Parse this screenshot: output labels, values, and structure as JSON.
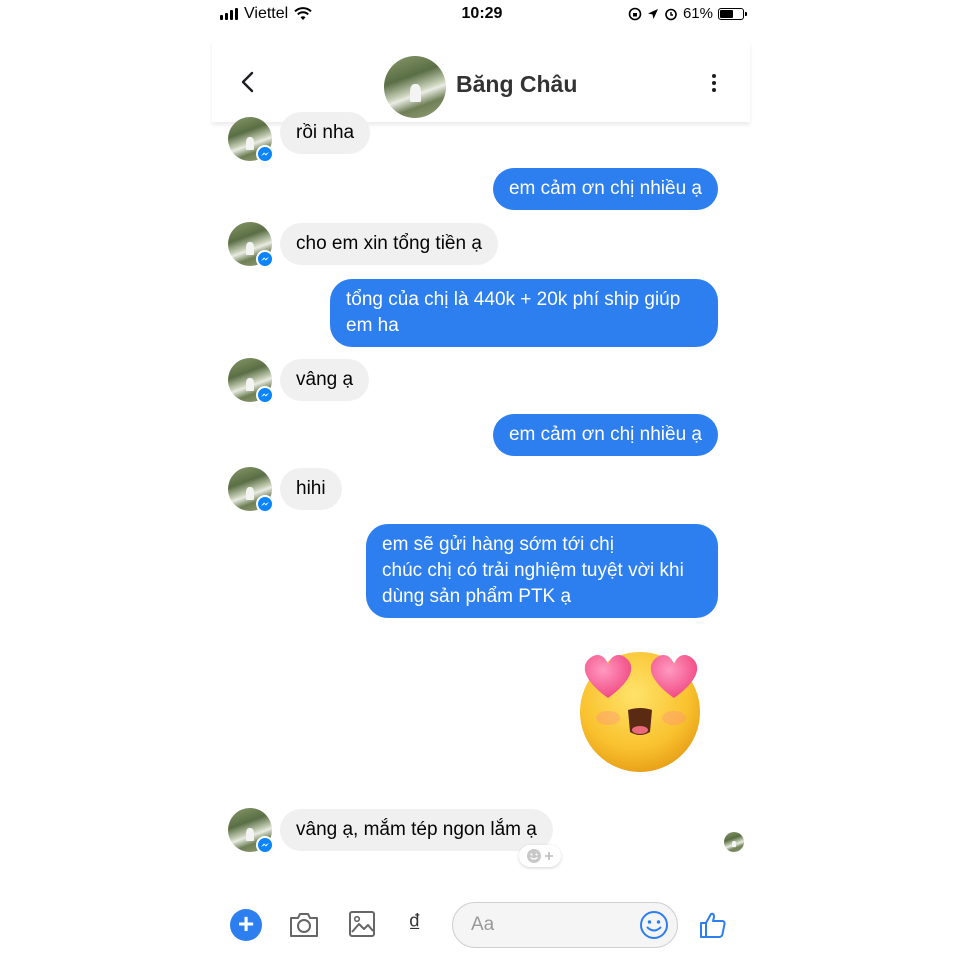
{
  "status_bar": {
    "carrier": "Viettel",
    "time": "10:29",
    "battery_percent": "61%",
    "battery_level": 0.61
  },
  "header": {
    "contact_name": "Băng Châu"
  },
  "messages": [
    {
      "from": "contact",
      "text": "rồi nha"
    },
    {
      "from": "me",
      "text": "em cảm ơn chị nhiều ạ"
    },
    {
      "from": "contact",
      "text": "cho em xin tổng tiền ạ"
    },
    {
      "from": "me",
      "text": "tổng của chị là 440k + 20k phí ship giúp\nem ha"
    },
    {
      "from": "contact",
      "text": "vâng ạ"
    },
    {
      "from": "me",
      "text": "em cảm ơn chị nhiều ạ"
    },
    {
      "from": "contact",
      "text": "hihi"
    },
    {
      "from": "me",
      "text": "em sẽ gửi hàng sớm tới chị\nchúc chị có trải nghiệm tuyệt vời khi\ndùng sản phẩm PTK ạ"
    },
    {
      "from": "me",
      "type": "sticker",
      "icon": "heart-eyes-emoji-icon"
    },
    {
      "from": "contact",
      "text": "vâng ạ, mắm tép ngon lắm ạ"
    }
  ],
  "composer": {
    "placeholder": "Aa",
    "payment_symbol": "₫"
  },
  "colors": {
    "outgoing_bubble": "#2d7ff0",
    "incoming_bubble": "#f0f0f0",
    "accent": "#2d7ff0"
  }
}
